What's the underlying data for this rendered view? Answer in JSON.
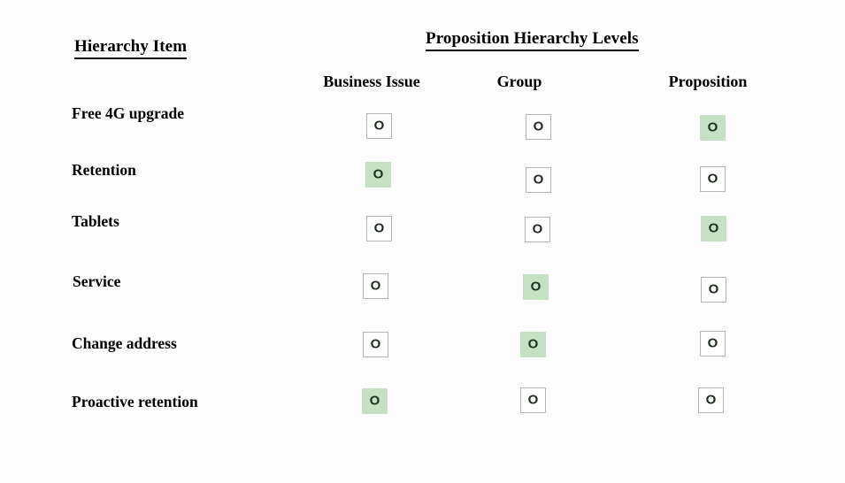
{
  "title_left": "Hierarchy Item",
  "title_right": "Proposition Hierarchy Levels",
  "columns": [
    {
      "label": "Business Issue"
    },
    {
      "label": "Group"
    },
    {
      "label": "Proposition"
    }
  ],
  "mark_glyph": "O",
  "colors": {
    "selected_fill": "#c5e0c2",
    "cell_border": "#b4b4b4",
    "background": "#fdfdfd",
    "text": "#000000"
  },
  "rows": [
    {
      "label": "Free 4G upgrade",
      "selected": "Proposition",
      "cells": [
        false,
        false,
        true
      ]
    },
    {
      "label": "Retention",
      "selected": "Business Issue",
      "cells": [
        true,
        false,
        false
      ]
    },
    {
      "label": "Tablets",
      "selected": "Proposition",
      "cells": [
        false,
        false,
        true
      ]
    },
    {
      "label": "Service",
      "selected": "Group",
      "cells": [
        false,
        true,
        false
      ]
    },
    {
      "label": "Change address",
      "selected": "Group",
      "cells": [
        false,
        true,
        false
      ]
    },
    {
      "label": "Proactive retention",
      "selected": "Business Issue",
      "cells": [
        true,
        false,
        false
      ]
    }
  ]
}
